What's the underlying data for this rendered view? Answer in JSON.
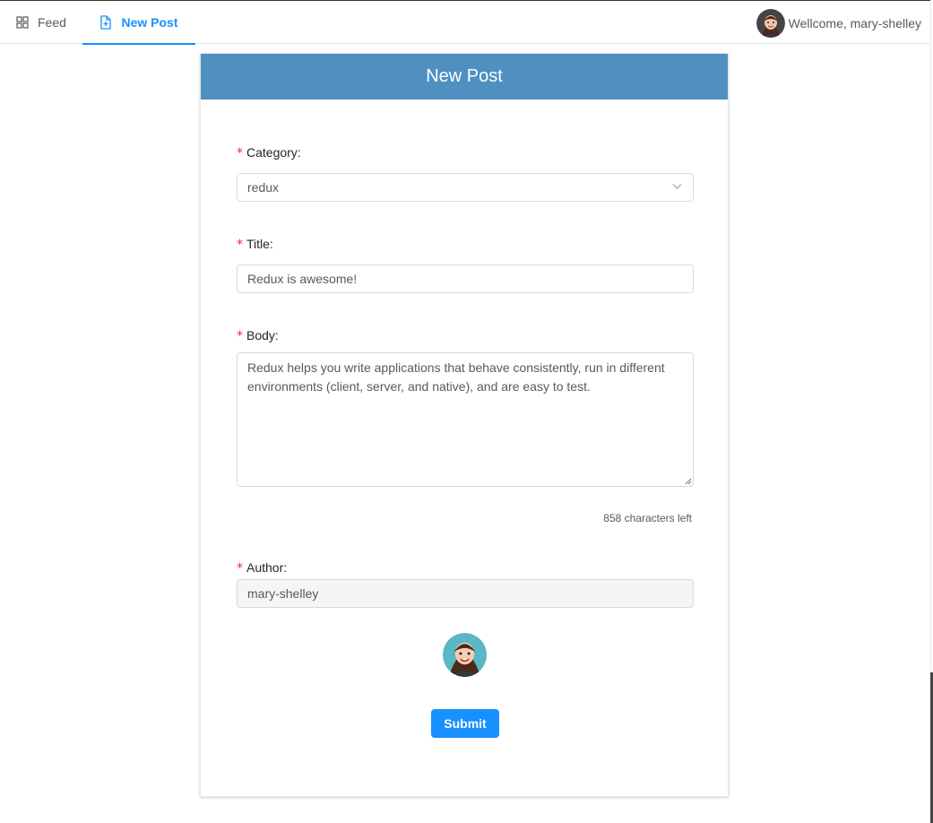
{
  "nav": {
    "feed_label": "Feed",
    "new_post_label": "New Post",
    "welcome_text": "Wellcome, mary-shelley"
  },
  "form": {
    "heading": "New Post",
    "category": {
      "label": "Category:",
      "value": "redux"
    },
    "title": {
      "label": "Title:",
      "value": "Redux is awesome!"
    },
    "body": {
      "label": "Body:",
      "value": "Redux helps you write applications that behave consistently, run in different environments (client, server, and native), and are easy to test."
    },
    "counter_text": "858 characters left",
    "author": {
      "label": "Author:",
      "value": "mary-shelley"
    },
    "submit_label": "Submit"
  },
  "colors": {
    "accent": "#1890ff",
    "header_bg": "#4f90c1",
    "required": "#f5222d"
  },
  "icons": [
    "appstore-icon",
    "file-add-icon",
    "chevron-down-icon",
    "avatar"
  ]
}
